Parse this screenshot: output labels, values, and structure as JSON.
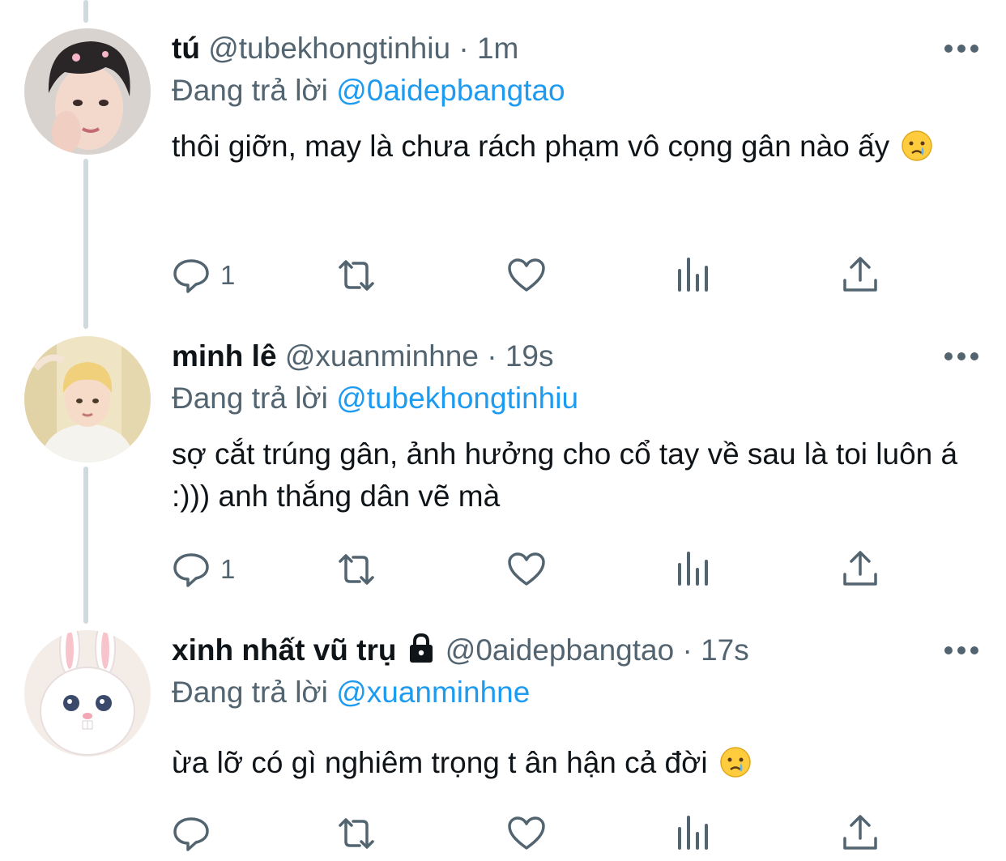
{
  "tweets": [
    {
      "name": "tú",
      "handle": "@tubekhongtinhiu",
      "time": "1m",
      "replying_label": "Đang trả lời",
      "replying_to": "@0aidepbangtao",
      "text": "thôi giỡn, may là chưa rách phạm vô cọng gân nào ấy",
      "emoji": "crying-face-emoji",
      "reply_count": "1",
      "avatar": "avatar-dark-hair-boy"
    },
    {
      "name": "minh lê",
      "handle": "@xuanminhne",
      "time": "19s",
      "replying_label": "Đang trả lời",
      "replying_to": "@tubekhongtinhiu",
      "text": "sợ cắt trúng gân, ảnh hưởng cho cổ tay về sau là toi luôn á :))) anh thắng dân vẽ mà",
      "reply_count": "1",
      "avatar": "avatar-blond-boy"
    },
    {
      "name": "xinh nhất vũ trụ",
      "locked_icon": "lock-icon",
      "handle": "@0aidepbangtao",
      "time": "17s",
      "replying_label": "Đang trả lời",
      "replying_to": "@xuanminhne",
      "text": "ừa lỡ có gì nghiêm trọng t ân hận cả đời",
      "emoji": "crying-face-emoji",
      "reply_count": "",
      "avatar": "avatar-white-bunny"
    }
  ],
  "separator": "·",
  "icons": [
    "reply-icon",
    "retweet-icon",
    "like-icon",
    "analytics-icon",
    "share-icon",
    "more-icon"
  ],
  "colors": {
    "link": "#1d9bf0",
    "secondary": "#536471",
    "text": "#0f1419",
    "thread": "#cfd9de"
  }
}
